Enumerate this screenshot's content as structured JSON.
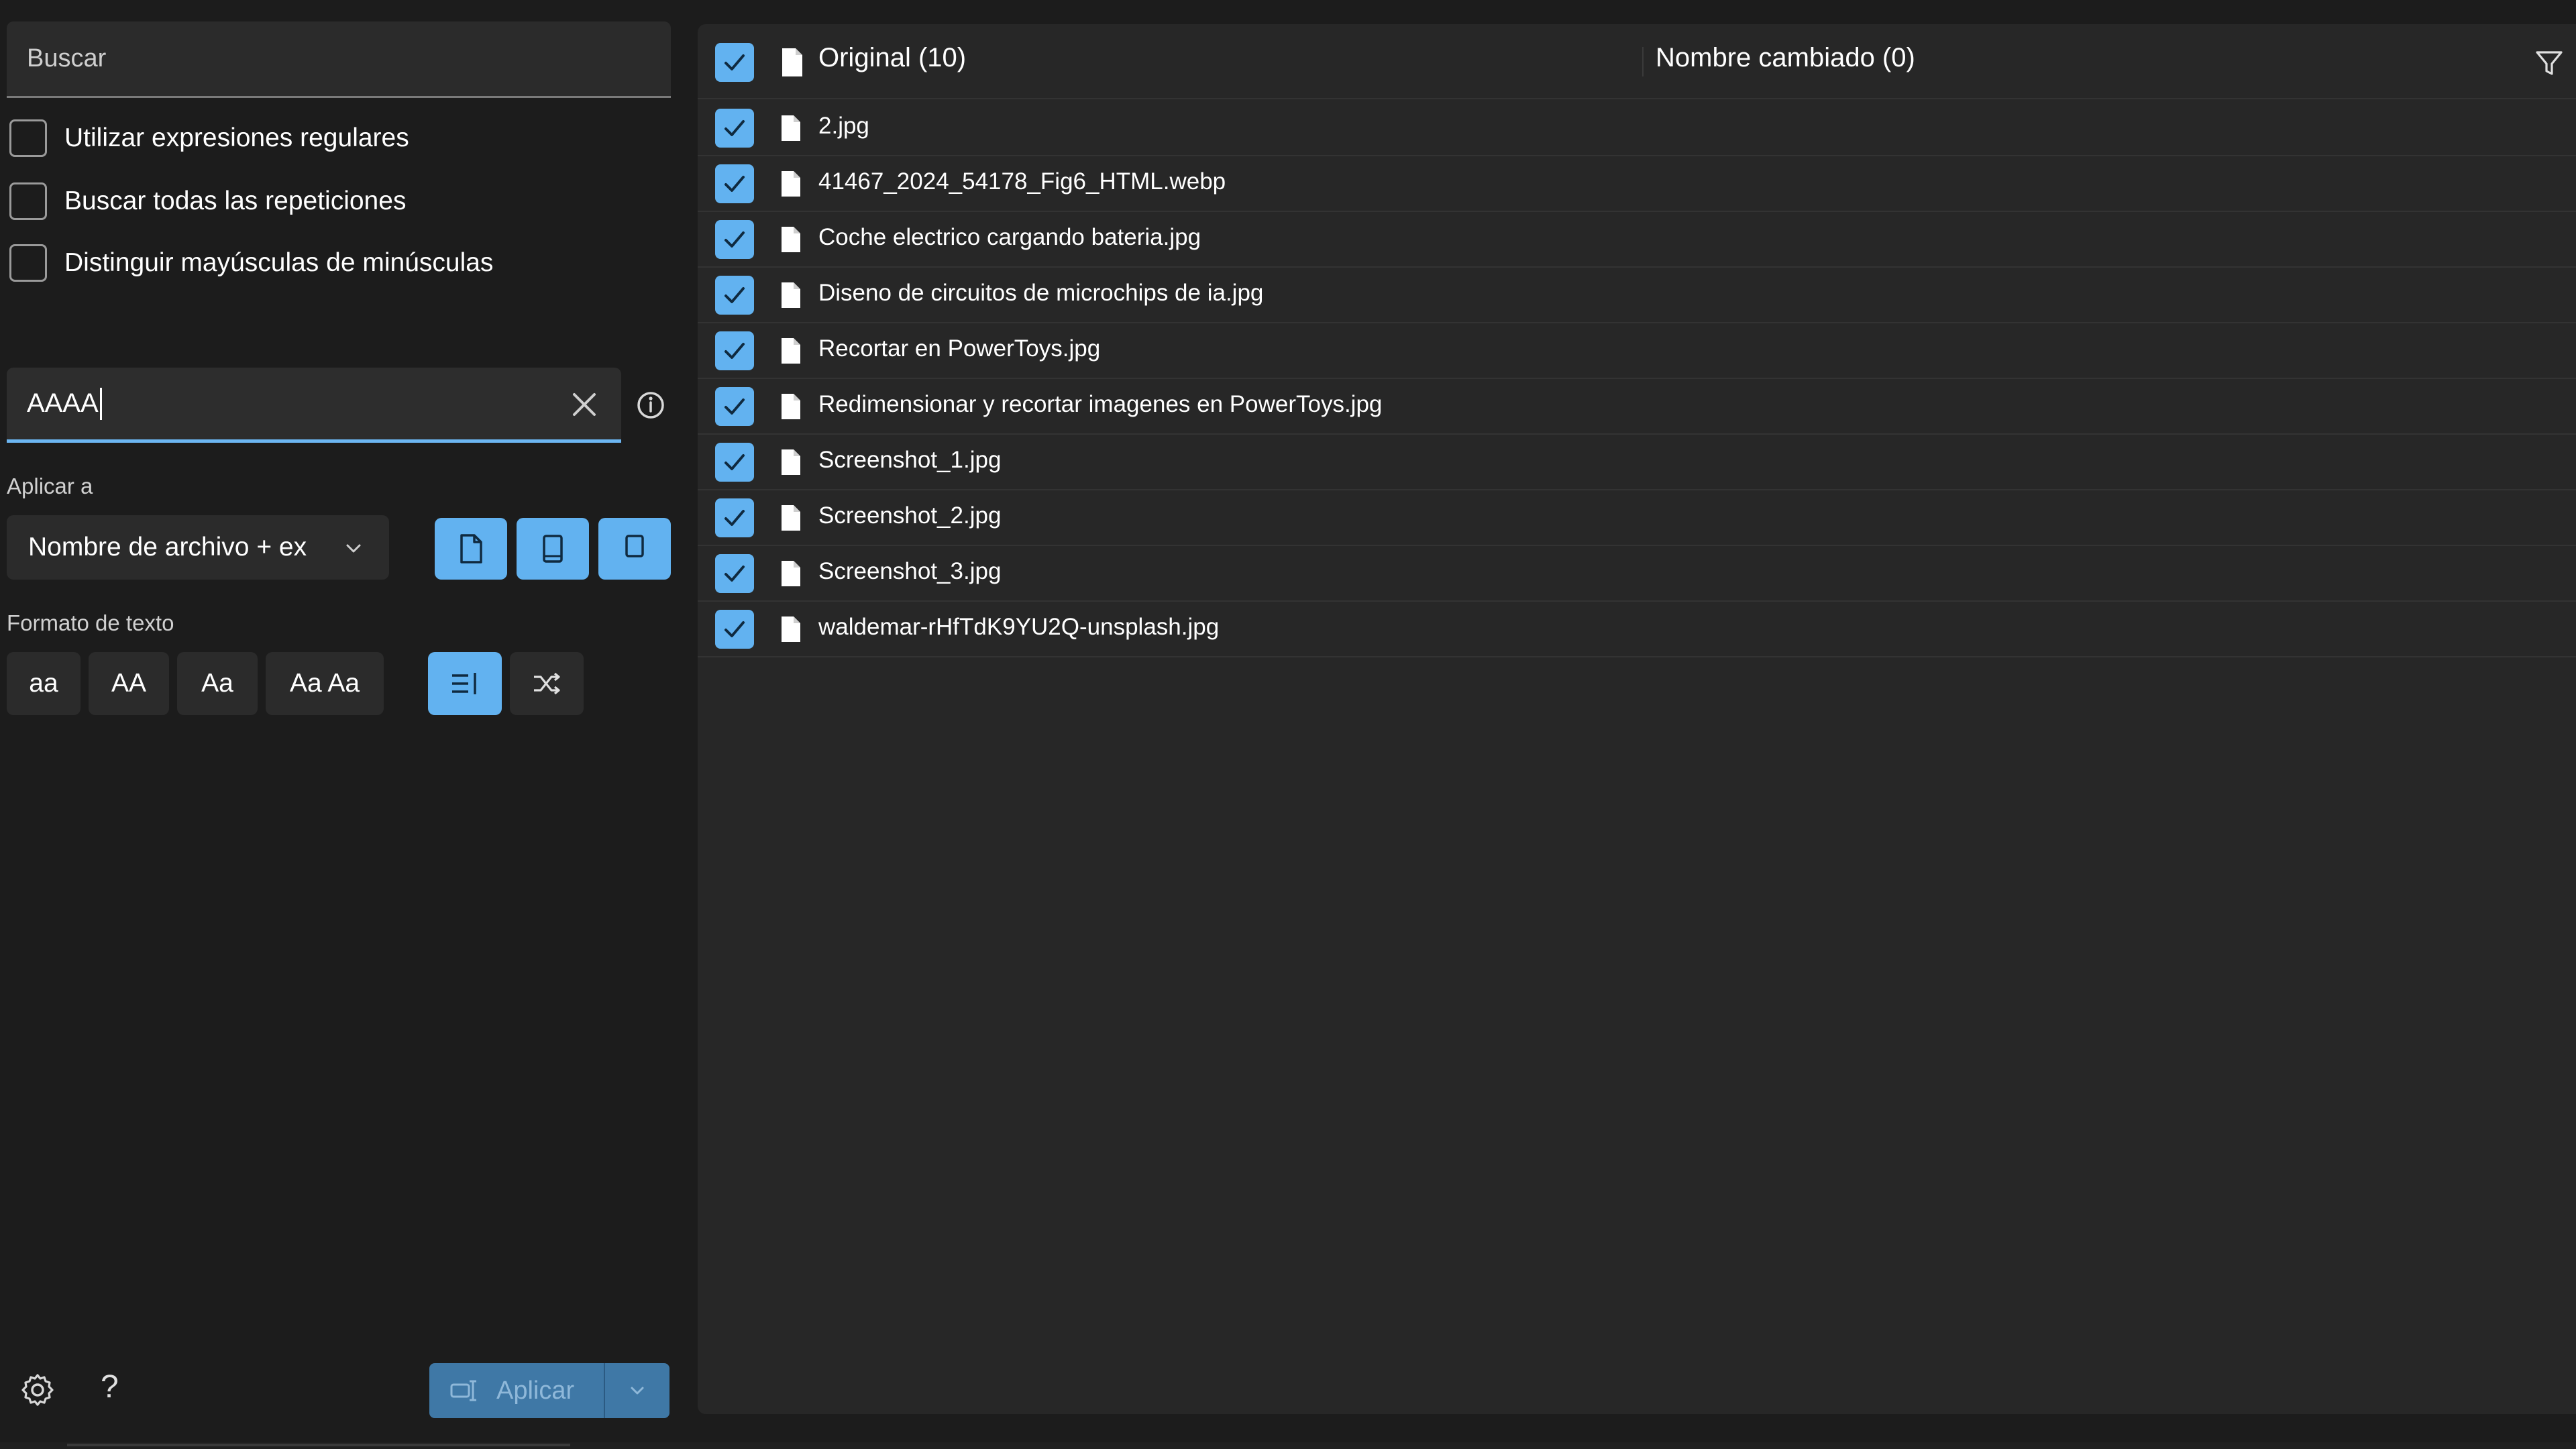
{
  "search": {
    "placeholder": "Buscar",
    "options": [
      {
        "label": "Utilizar expresiones regulares",
        "checked": false
      },
      {
        "label": "Buscar todas las repeticiones",
        "checked": false
      },
      {
        "label": "Distinguir mayúsculas de minúsculas",
        "checked": false
      }
    ]
  },
  "replace": {
    "value": "AAAA"
  },
  "apply_to": {
    "label": "Aplicar a",
    "selected": "Nombre de archivo + ex"
  },
  "text_format": {
    "label": "Formato de texto",
    "buttons": [
      "aa",
      "AA",
      "Aa",
      "Aa Aa"
    ]
  },
  "footer": {
    "help": "?",
    "apply_label": "Aplicar"
  },
  "list": {
    "original_header": "Original (10)",
    "renamed_header": "Nombre cambiado (0)",
    "files": [
      "2.jpg",
      "41467_2024_54178_Fig6_HTML.webp",
      "Coche electrico cargando bateria.jpg",
      "Diseno de circuitos de microchips de ia.jpg",
      "Recortar en PowerToys.jpg",
      "Redimensionar y recortar imagenes en PowerToys.jpg",
      "Screenshot_1.jpg",
      "Screenshot_2.jpg",
      "Screenshot_3.jpg",
      "waldemar-rHfTdK9YU2Q-unsplash.jpg"
    ]
  },
  "colors": {
    "accent": "#62b2f0",
    "background": "#1c1c1c",
    "panel": "#272727"
  }
}
